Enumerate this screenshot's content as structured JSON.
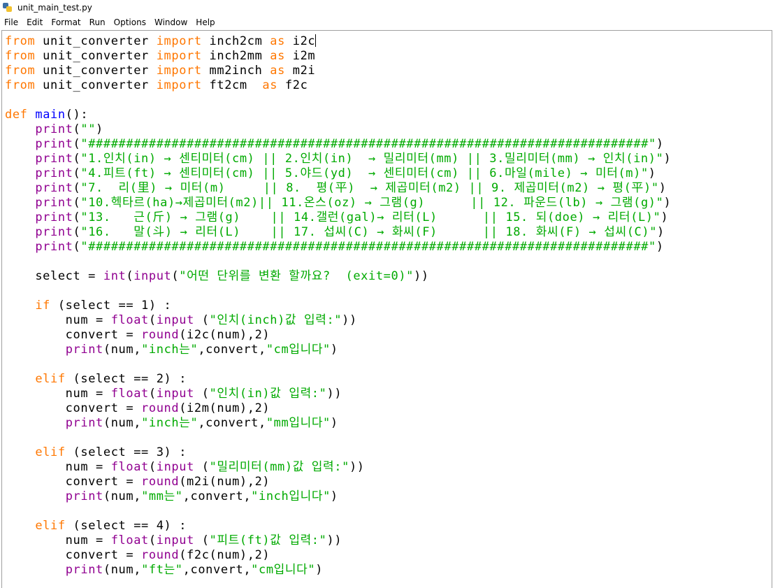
{
  "window": {
    "title": "unit_main_test.py"
  },
  "menu": [
    "File",
    "Edit",
    "Format",
    "Run",
    "Options",
    "Window",
    "Help"
  ],
  "colors": {
    "keyword": "#ff7700",
    "builtin": "#900090",
    "string": "#00aa00",
    "definition": "#0000ff",
    "text": "#000000"
  },
  "code_lines": [
    [
      [
        "k",
        "from"
      ],
      [
        "t",
        " unit_converter "
      ],
      [
        "k",
        "import"
      ],
      [
        "t",
        " inch2cm "
      ],
      [
        "k",
        "as"
      ],
      [
        "t",
        " i2c"
      ]
    ],
    [
      [
        "k",
        "from"
      ],
      [
        "t",
        " unit_converter "
      ],
      [
        "k",
        "import"
      ],
      [
        "t",
        " inch2mm "
      ],
      [
        "k",
        "as"
      ],
      [
        "t",
        " i2m"
      ]
    ],
    [
      [
        "k",
        "from"
      ],
      [
        "t",
        " unit_converter "
      ],
      [
        "k",
        "import"
      ],
      [
        "t",
        " mm2inch "
      ],
      [
        "k",
        "as"
      ],
      [
        "t",
        " m2i"
      ]
    ],
    [
      [
        "k",
        "from"
      ],
      [
        "t",
        " unit_converter "
      ],
      [
        "k",
        "import"
      ],
      [
        "t",
        " ft2cm  "
      ],
      [
        "k",
        "as"
      ],
      [
        "t",
        " f2c"
      ]
    ],
    [],
    [
      [
        "k",
        "def"
      ],
      [
        "t",
        " "
      ],
      [
        "d",
        "main"
      ],
      [
        "t",
        "():"
      ]
    ],
    [
      [
        "t",
        "    "
      ],
      [
        "b",
        "print"
      ],
      [
        "t",
        "("
      ],
      [
        "s",
        "\"\""
      ],
      [
        "t",
        ")"
      ]
    ],
    [
      [
        "t",
        "    "
      ],
      [
        "b",
        "print"
      ],
      [
        "t",
        "("
      ],
      [
        "s",
        "\"##########################################################################\""
      ],
      [
        "t",
        ")"
      ]
    ],
    [
      [
        "t",
        "    "
      ],
      [
        "b",
        "print"
      ],
      [
        "t",
        "("
      ],
      [
        "s",
        "\"1.인치(in) → 센티미터(cm) || 2.인치(in)  → 밀리미터(mm) || 3.밀리미터(mm) → 인치(in)\""
      ],
      [
        "t",
        ")"
      ]
    ],
    [
      [
        "t",
        "    "
      ],
      [
        "b",
        "print"
      ],
      [
        "t",
        "("
      ],
      [
        "s",
        "\"4.피트(ft) → 센티미터(cm) || 5.야드(yd)  → 센티미터(cm) || 6.마일(mile) → 미터(m)\""
      ],
      [
        "t",
        ")"
      ]
    ],
    [
      [
        "t",
        "    "
      ],
      [
        "b",
        "print"
      ],
      [
        "t",
        "("
      ],
      [
        "s",
        "\"7.  리(里) → 미터(m)     || 8.  평(平)  → 제곱미터(m2) || 9. 제곱미터(m2) → 평(平)\""
      ],
      [
        "t",
        ")"
      ]
    ],
    [
      [
        "t",
        "    "
      ],
      [
        "b",
        "print"
      ],
      [
        "t",
        "("
      ],
      [
        "s",
        "\"10.헥타르(ha)→제곱미터(m2)|| 11.온스(oz) → 그램(g)      || 12. 파운드(lb) → 그램(g)\""
      ],
      [
        "t",
        ")"
      ]
    ],
    [
      [
        "t",
        "    "
      ],
      [
        "b",
        "print"
      ],
      [
        "t",
        "("
      ],
      [
        "s",
        "\"13.   근(斤) → 그램(g)    || 14.갤런(gal)→ 리터(L)      || 15. 되(doe) → 리터(L)\""
      ],
      [
        "t",
        ")"
      ]
    ],
    [
      [
        "t",
        "    "
      ],
      [
        "b",
        "print"
      ],
      [
        "t",
        "("
      ],
      [
        "s",
        "\"16.   말(斗) → 리터(L)    || 17. 섭씨(C) → 화씨(F)      || 18. 화씨(F) → 섭씨(C)\""
      ],
      [
        "t",
        ")"
      ]
    ],
    [
      [
        "t",
        "    "
      ],
      [
        "b",
        "print"
      ],
      [
        "t",
        "("
      ],
      [
        "s",
        "\"##########################################################################\""
      ],
      [
        "t",
        ")"
      ]
    ],
    [],
    [
      [
        "t",
        "    select = "
      ],
      [
        "b",
        "int"
      ],
      [
        "t",
        "("
      ],
      [
        "b",
        "input"
      ],
      [
        "t",
        "("
      ],
      [
        "s",
        "\"어떤 단위를 변환 할까요?  (exit=0)\""
      ],
      [
        "t",
        "))"
      ]
    ],
    [],
    [
      [
        "t",
        "    "
      ],
      [
        "k",
        "if"
      ],
      [
        "t",
        " (select == 1) :"
      ]
    ],
    [
      [
        "t",
        "        num = "
      ],
      [
        "b",
        "float"
      ],
      [
        "t",
        "("
      ],
      [
        "b",
        "input"
      ],
      [
        "t",
        " ("
      ],
      [
        "s",
        "\"인치(inch)값 입력:\""
      ],
      [
        "t",
        "))"
      ]
    ],
    [
      [
        "t",
        "        convert = "
      ],
      [
        "b",
        "round"
      ],
      [
        "t",
        "(i2c(num),2)"
      ]
    ],
    [
      [
        "t",
        "        "
      ],
      [
        "b",
        "print"
      ],
      [
        "t",
        "(num,"
      ],
      [
        "s",
        "\"inch는\""
      ],
      [
        "t",
        ",convert,"
      ],
      [
        "s",
        "\"cm입니다\""
      ],
      [
        "t",
        ")"
      ]
    ],
    [],
    [
      [
        "t",
        "    "
      ],
      [
        "k",
        "elif"
      ],
      [
        "t",
        " (select == 2) :"
      ]
    ],
    [
      [
        "t",
        "        num = "
      ],
      [
        "b",
        "float"
      ],
      [
        "t",
        "("
      ],
      [
        "b",
        "input"
      ],
      [
        "t",
        " ("
      ],
      [
        "s",
        "\"인치(in)값 입력:\""
      ],
      [
        "t",
        "))"
      ]
    ],
    [
      [
        "t",
        "        convert = "
      ],
      [
        "b",
        "round"
      ],
      [
        "t",
        "(i2m(num),2)"
      ]
    ],
    [
      [
        "t",
        "        "
      ],
      [
        "b",
        "print"
      ],
      [
        "t",
        "(num,"
      ],
      [
        "s",
        "\"inch는\""
      ],
      [
        "t",
        ",convert,"
      ],
      [
        "s",
        "\"mm입니다\""
      ],
      [
        "t",
        ")"
      ]
    ],
    [],
    [
      [
        "t",
        "    "
      ],
      [
        "k",
        "elif"
      ],
      [
        "t",
        " (select == 3) :"
      ]
    ],
    [
      [
        "t",
        "        num = "
      ],
      [
        "b",
        "float"
      ],
      [
        "t",
        "("
      ],
      [
        "b",
        "input"
      ],
      [
        "t",
        " ("
      ],
      [
        "s",
        "\"밀리미터(mm)값 입력:\""
      ],
      [
        "t",
        "))"
      ]
    ],
    [
      [
        "t",
        "        convert = "
      ],
      [
        "b",
        "round"
      ],
      [
        "t",
        "(m2i(num),2)"
      ]
    ],
    [
      [
        "t",
        "        "
      ],
      [
        "b",
        "print"
      ],
      [
        "t",
        "(num,"
      ],
      [
        "s",
        "\"mm는\""
      ],
      [
        "t",
        ",convert,"
      ],
      [
        "s",
        "\"inch입니다\""
      ],
      [
        "t",
        ")"
      ]
    ],
    [],
    [
      [
        "t",
        "    "
      ],
      [
        "k",
        "elif"
      ],
      [
        "t",
        " (select == 4) :"
      ]
    ],
    [
      [
        "t",
        "        num = "
      ],
      [
        "b",
        "float"
      ],
      [
        "t",
        "("
      ],
      [
        "b",
        "input"
      ],
      [
        "t",
        " ("
      ],
      [
        "s",
        "\"피트(ft)값 입력:\""
      ],
      [
        "t",
        "))"
      ]
    ],
    [
      [
        "t",
        "        convert = "
      ],
      [
        "b",
        "round"
      ],
      [
        "t",
        "(f2c(num),2)"
      ]
    ],
    [
      [
        "t",
        "        "
      ],
      [
        "b",
        "print"
      ],
      [
        "t",
        "(num,"
      ],
      [
        "s",
        "\"ft는\""
      ],
      [
        "t",
        ",convert,"
      ],
      [
        "s",
        "\"cm입니다\""
      ],
      [
        "t",
        ")"
      ]
    ]
  ]
}
